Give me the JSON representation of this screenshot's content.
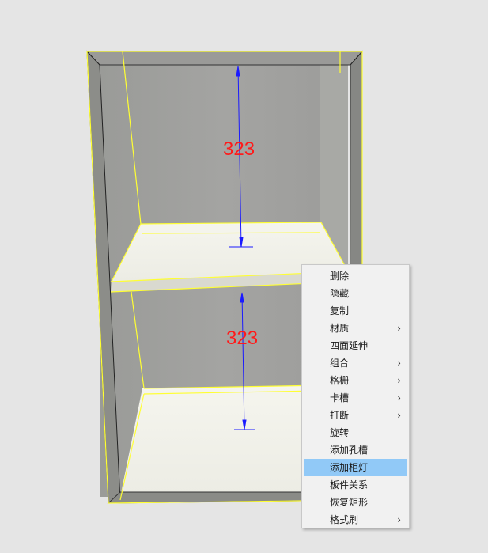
{
  "viewport": {
    "dimensions": [
      {
        "name": "upper-dimension",
        "label": "323"
      },
      {
        "name": "lower-dimension",
        "label": "323"
      }
    ],
    "colors": {
      "background": "#e5e5e5",
      "cabinet_side": "#8c8d89",
      "cabinet_back": "#a3a3a1",
      "shelf": "#f1f1ea",
      "selection_outline": "#ffff33",
      "dimension_line": "#1a1aff",
      "dimension_text": "#ff1a1a"
    }
  },
  "context_menu": {
    "highlight_color": "#91c9f7",
    "items": [
      {
        "label": "删除",
        "has_submenu": false,
        "highlighted": false
      },
      {
        "label": "隐藏",
        "has_submenu": false,
        "highlighted": false
      },
      {
        "label": "复制",
        "has_submenu": false,
        "highlighted": false
      },
      {
        "label": "材质",
        "has_submenu": true,
        "highlighted": false
      },
      {
        "label": "四面延伸",
        "has_submenu": false,
        "highlighted": false
      },
      {
        "label": "组合",
        "has_submenu": true,
        "highlighted": false
      },
      {
        "label": "格栅",
        "has_submenu": true,
        "highlighted": false
      },
      {
        "label": "卡槽",
        "has_submenu": true,
        "highlighted": false
      },
      {
        "label": "打断",
        "has_submenu": true,
        "highlighted": false
      },
      {
        "label": "旋转",
        "has_submenu": false,
        "highlighted": false
      },
      {
        "label": "添加孔槽",
        "has_submenu": false,
        "highlighted": false
      },
      {
        "label": "添加柜灯",
        "has_submenu": false,
        "highlighted": true
      },
      {
        "label": "板件关系",
        "has_submenu": false,
        "highlighted": false
      },
      {
        "label": "恢复矩形",
        "has_submenu": false,
        "highlighted": false
      },
      {
        "label": "格式刷",
        "has_submenu": true,
        "highlighted": false
      }
    ],
    "submenu_arrow": "›"
  }
}
